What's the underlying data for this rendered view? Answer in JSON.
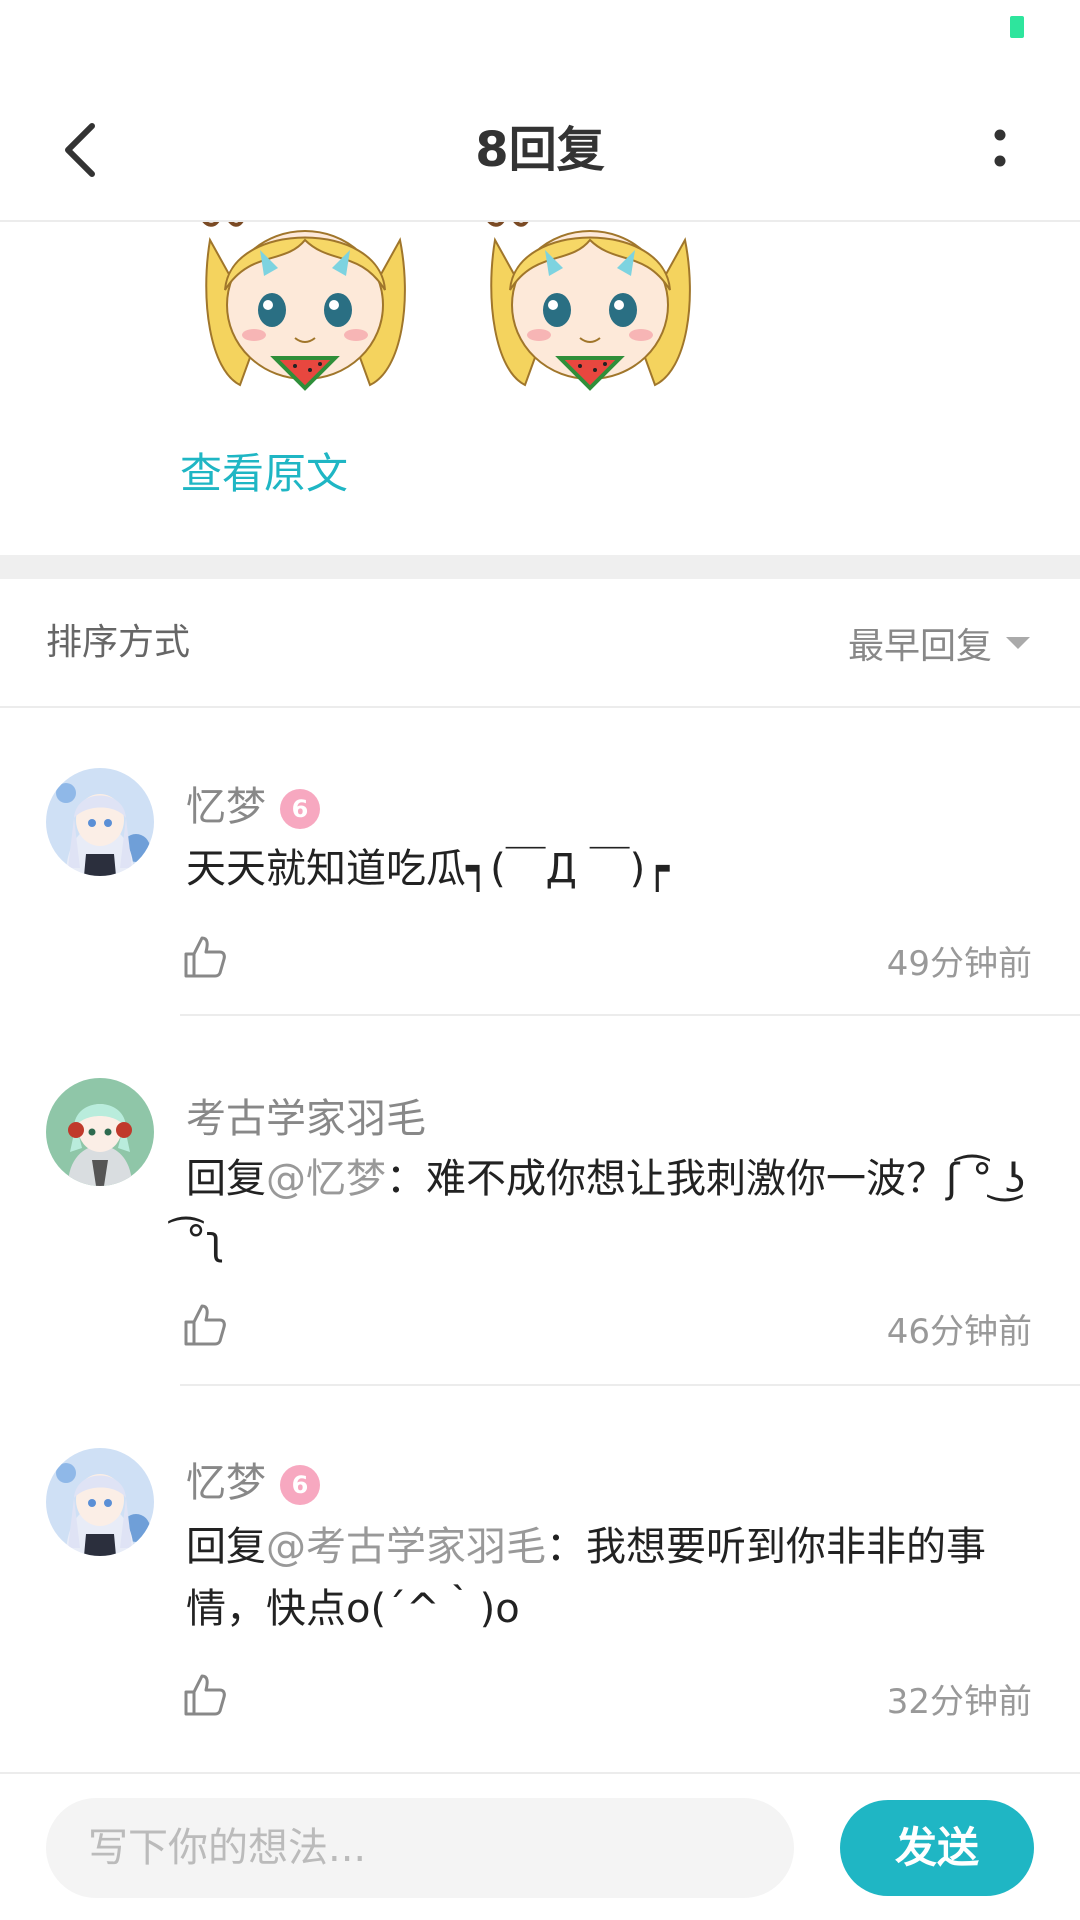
{
  "header": {
    "title": "8回复"
  },
  "original": {
    "view_original_label": "查看原文"
  },
  "sort": {
    "label": "排序方式",
    "value": "最早回复"
  },
  "comments": [
    {
      "username": "忆梦",
      "badge": "6",
      "mention": "",
      "text": "天天就知道吃瓜┑(￣Д ￣)┍",
      "time": "49分钟前"
    },
    {
      "username": "考古学家羽毛",
      "badge": "",
      "reply_prefix": "回复",
      "mention": "@忆梦",
      "text": "：难不成你想让我刺激你一波？ʃ ͡° ͜ʖ ͡°ʅ",
      "time": "46分钟前"
    },
    {
      "username": "忆梦",
      "badge": "6",
      "reply_prefix": "回复",
      "mention": "@考古学家羽毛",
      "text": "：我想要听到你非非的事情，快点o(´^｀)o",
      "time": "32分钟前"
    }
  ],
  "input": {
    "placeholder": "写下你的想法..."
  },
  "send_label": "发送",
  "colors": {
    "accent": "#1fb6c4",
    "status_indicator": "#2ee59d",
    "badge_pink": "#f7a8c0"
  }
}
